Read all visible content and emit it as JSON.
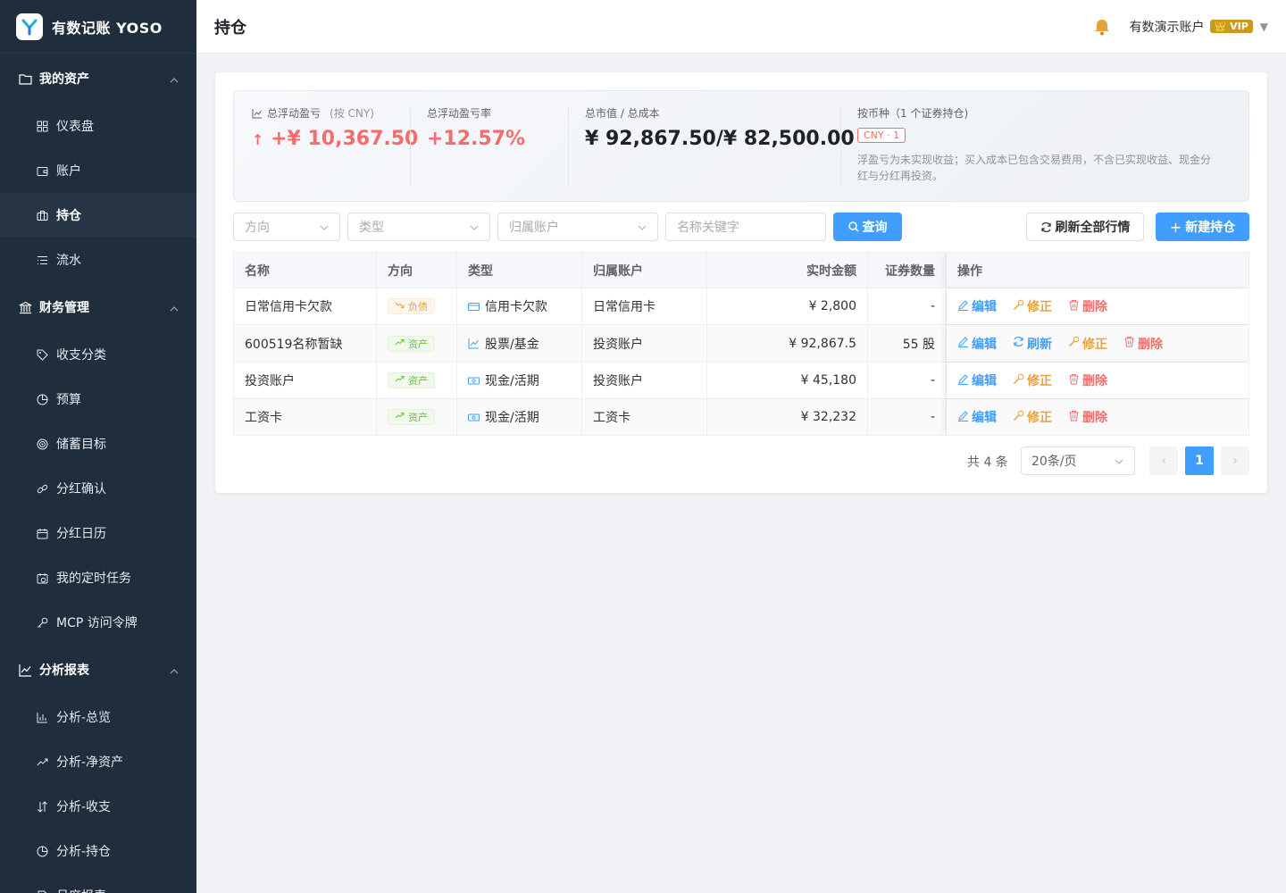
{
  "brand": {
    "name": "有数记账 YOSO"
  },
  "sidebar": {
    "groups": [
      {
        "title": "我的资产",
        "items": [
          "仪表盘",
          "账户",
          "持仓",
          "流水"
        ]
      },
      {
        "title": "财务管理",
        "items": [
          "收支分类",
          "预算",
          "储蓄目标",
          "分红确认",
          "分红日历",
          "我的定时任务",
          "MCP 访问令牌"
        ]
      },
      {
        "title": "分析报表",
        "items": [
          "分析-总览",
          "分析-净资产",
          "分析-收支",
          "分析-持仓",
          "月度报表"
        ]
      }
    ],
    "active": "持仓"
  },
  "header": {
    "title": "持仓",
    "user_name": "有数演示账户",
    "vip_label": "VIP"
  },
  "summary": {
    "float_pl_label": "总浮动盈亏",
    "float_pl_hint": "(按 CNY)",
    "float_pl_value": "+¥ 10,367.50",
    "float_rate_label": "总浮动盈亏率",
    "float_rate_value": "+12.57%",
    "market_cost_label": "总市值 / 总成本",
    "market_cost_value": "¥ 92,867.50/¥ 82,500.00",
    "currency_label": "按币种（1 个证券持仓)",
    "currency_tag": "CNY · 1",
    "note": "浮盈亏为未实现收益；买入成本已包含交易费用，不含已实现收益、现金分红与分红再投资。"
  },
  "filters": {
    "direction_placeholder": "方向",
    "type_placeholder": "类型",
    "account_placeholder": "归属账户",
    "keyword_placeholder": "名称关键字",
    "query_label": "查询",
    "refresh_all_label": "刷新全部行情",
    "new_label": "新建持仓"
  },
  "table": {
    "headers": [
      "名称",
      "方向",
      "类型",
      "归属账户",
      "实时金额",
      "证券数量",
      "操作"
    ],
    "rows": [
      {
        "name": "日常信用卡欠款",
        "direction": "负债",
        "dir_kind": "debt",
        "type": "信用卡欠款",
        "type_icon": "credit-card-icon",
        "account": "日常信用卡",
        "amount": "¥ 2,800",
        "qty": "-",
        "refresh": false
      },
      {
        "name": "600519名称暂缺",
        "direction": "资产",
        "dir_kind": "asset",
        "type": "股票/基金",
        "type_icon": "chart-line-icon",
        "account": "投资账户",
        "amount": "¥ 92,867.5",
        "qty": "55 股",
        "refresh": true
      },
      {
        "name": "投资账户",
        "direction": "资产",
        "dir_kind": "asset",
        "type": "现金/活期",
        "type_icon": "cash-icon",
        "account": "投资账户",
        "amount": "¥ 45,180",
        "qty": "-",
        "refresh": false
      },
      {
        "name": "工资卡",
        "direction": "资产",
        "dir_kind": "asset",
        "type": "现金/活期",
        "type_icon": "cash-icon",
        "account": "工资卡",
        "amount": "¥ 32,232",
        "qty": "-",
        "refresh": false
      }
    ],
    "actions": {
      "edit": "编辑",
      "refresh": "刷新",
      "fix": "修正",
      "delete": "删除"
    }
  },
  "pagination": {
    "total_text": "共 4 条",
    "page_size": "20条/页",
    "current_page": "1"
  }
}
